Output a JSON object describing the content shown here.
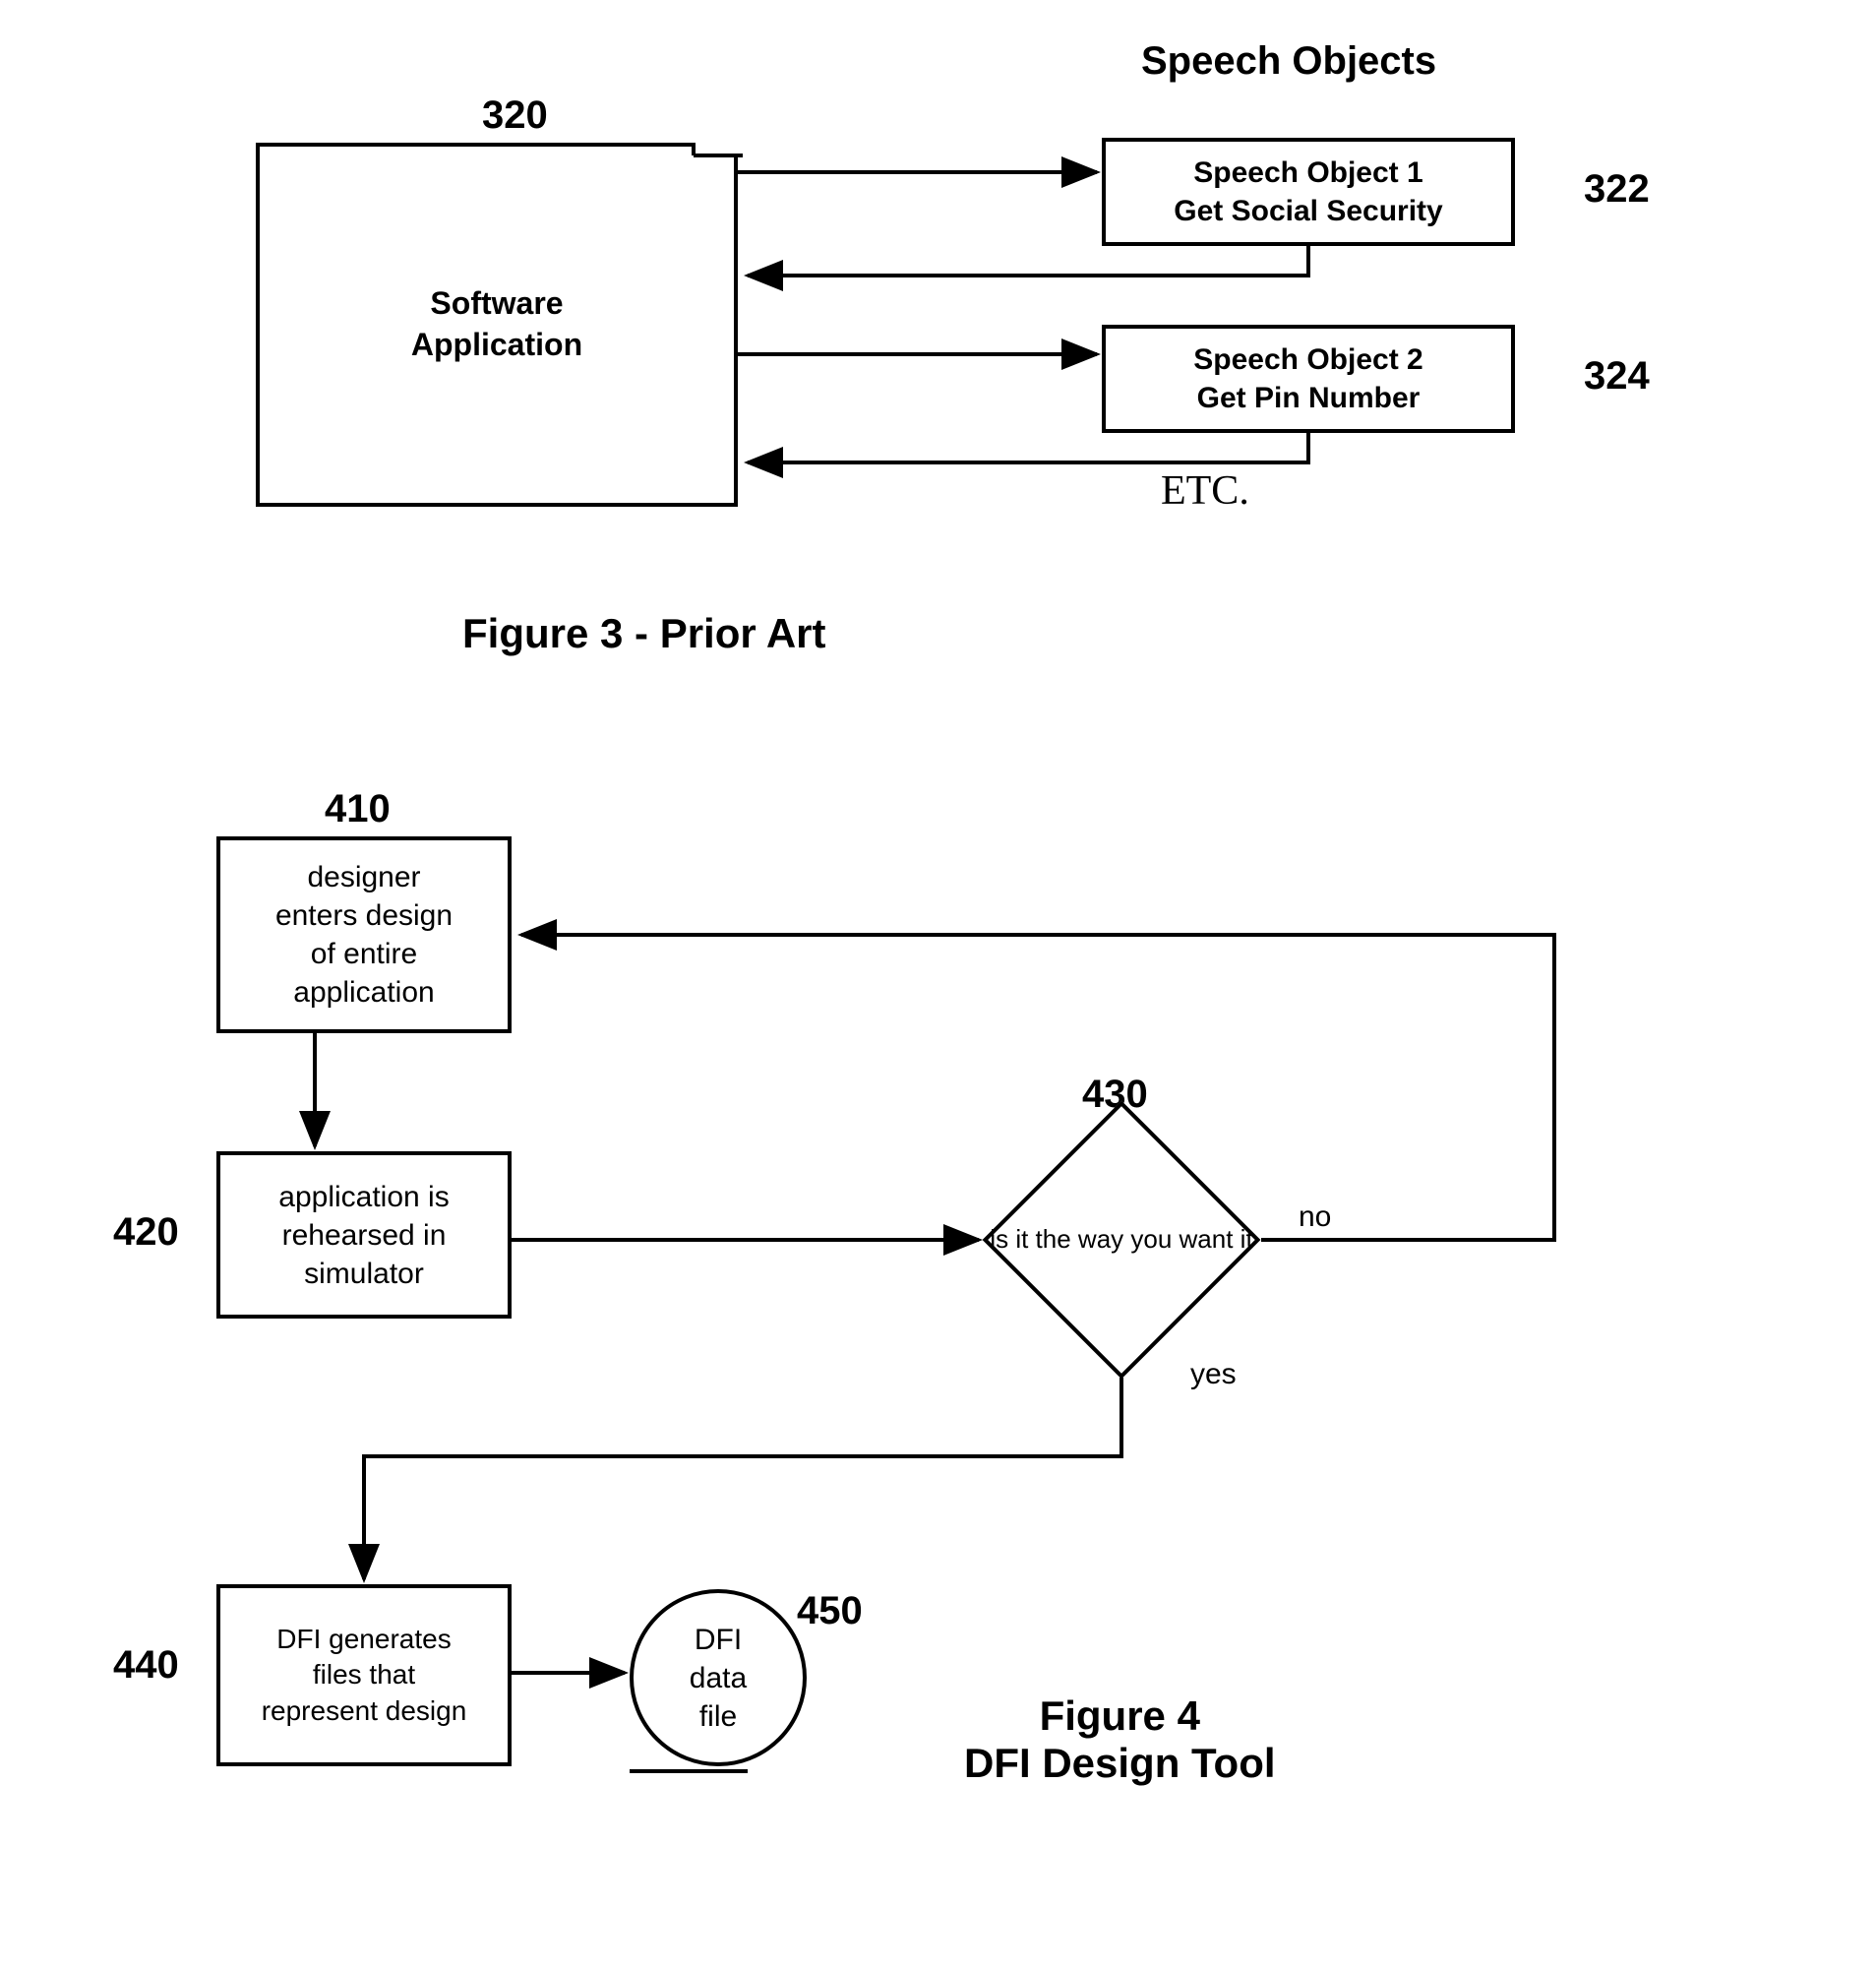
{
  "figure3": {
    "heading": "Speech Objects",
    "ref_320": "320",
    "ref_322": "322",
    "ref_324": "324",
    "box_app": "Software\nApplication",
    "box_so1": "Speech Object 1\nGet Social Security",
    "box_so2": "Speech Object 2\nGet Pin Number",
    "etc": "ETC.",
    "caption": "Figure 3 - Prior Art"
  },
  "figure4": {
    "ref_410": "410",
    "ref_420": "420",
    "ref_430": "430",
    "ref_440": "440",
    "ref_450": "450",
    "box_410": "designer\nenters design\nof entire\napplication",
    "box_420": "application is\nrehearsed in\nsimulator",
    "box_430": "is it\nthe way you\nwant it",
    "box_440": "DFI generates\nfiles that\nrepresent design",
    "circle_450": "DFI\ndata\nfile",
    "edge_no": "no",
    "edge_yes": "yes",
    "caption_l1": "Figure 4",
    "caption_l2": "DFI Design Tool"
  }
}
